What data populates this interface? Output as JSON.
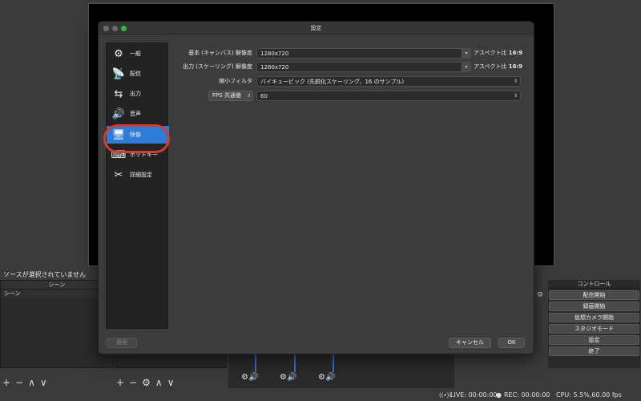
{
  "background": {
    "source_status": "ソースが選択されていません",
    "scenes_header": "シーン",
    "scene_item": "シーン",
    "controls_header": "コントロール",
    "controls": [
      "配信開始",
      "録画開始",
      "仮想カメラ開始",
      "スタジオモード",
      "設定",
      "終了"
    ],
    "toolbar_glyphs": [
      "+",
      "−",
      "∧",
      "∨"
    ],
    "sources_toolbar_glyphs": [
      "+",
      "−",
      "⚙",
      "∧",
      "∨"
    ],
    "status": {
      "live": "LIVE: 00:00:00",
      "rec": "REC: 00:00:00",
      "cpu": "CPU: 5.5%,60.00 fps"
    }
  },
  "dialog": {
    "title": "設定",
    "sidebar": [
      {
        "label": "一般",
        "icon": "gear-icon",
        "glyph": "⚙"
      },
      {
        "label": "配信",
        "icon": "broadcast-icon",
        "glyph": "📡"
      },
      {
        "label": "出力",
        "icon": "output-icon",
        "glyph": "⇆"
      },
      {
        "label": "音声",
        "icon": "speaker-icon",
        "glyph": "🔊"
      },
      {
        "label": "映像",
        "icon": "monitor-icon",
        "glyph": "🖥"
      },
      {
        "label": "ホットキー",
        "icon": "keyboard-icon",
        "glyph": "⌨"
      },
      {
        "label": "詳細設定",
        "icon": "tools-icon",
        "glyph": "✂"
      }
    ],
    "active_item": "映像",
    "video": {
      "base_label": "基本 (キャンバス) 解像度",
      "base_value": "1280x720",
      "output_label": "出力 (スケーリング) 解像度",
      "output_value": "1280x720",
      "aspect_prefix": "アスペクト比",
      "aspect_value": "16:9",
      "filter_label": "縮小フィルタ",
      "filter_value": "バイキュービック (先鋭化スケーリング、16 のサンプル)",
      "fps_mode": "FPS 共通値",
      "fps_value": "60"
    },
    "buttons": {
      "apply": "適用",
      "cancel": "キャンセル",
      "ok": "OK"
    },
    "colors": {
      "accent": "#2f7bd8",
      "highlight_ring": "#d83a2e"
    }
  }
}
